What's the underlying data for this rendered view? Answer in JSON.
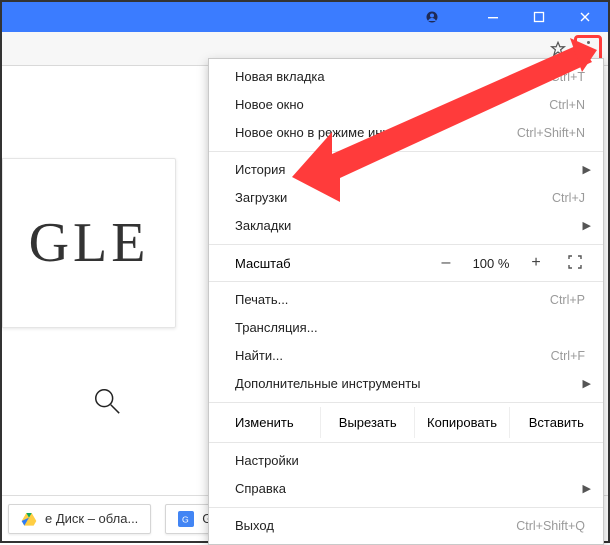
{
  "titlebar": {
    "profile_icon": "user-circle",
    "minimize_icon": "minimize",
    "maximize_icon": "maximize",
    "close_icon": "close"
  },
  "omnirow": {
    "star_icon": "star-outline",
    "kebab_icon": "more-vertical"
  },
  "page": {
    "doodle_text": "GLE",
    "search_icon": "magnifier"
  },
  "menu": {
    "new_tab": {
      "label": "Новая вкладка",
      "accel": "Ctrl+T"
    },
    "new_window": {
      "label": "Новое окно",
      "accel": "Ctrl+N"
    },
    "incognito": {
      "label": "Новое окно в режиме инкогнито",
      "accel": "Ctrl+Shift+N"
    },
    "history": {
      "label": "История"
    },
    "downloads": {
      "label": "Загрузки",
      "accel": "Ctrl+J"
    },
    "bookmarks": {
      "label": "Закладки"
    },
    "zoom": {
      "label": "Масштаб",
      "minus": "–",
      "value": "100 %",
      "plus": "+"
    },
    "print": {
      "label": "Печать...",
      "accel": "Ctrl+P"
    },
    "cast": {
      "label": "Трансляция..."
    },
    "find": {
      "label": "Найти...",
      "accel": "Ctrl+F"
    },
    "more_tools": {
      "label": "Дополнительные инструменты"
    },
    "edit": {
      "label": "Изменить",
      "cut": "Вырезать",
      "copy": "Копировать",
      "paste": "Вставить"
    },
    "settings": {
      "label": "Настройки"
    },
    "help": {
      "label": "Справка"
    },
    "exit": {
      "label": "Выход",
      "accel": "Ctrl+Shift+Q"
    }
  },
  "tabs": {
    "drive": {
      "label": "е Диск – обла..."
    },
    "translate": {
      "label": "Google Переводчик"
    }
  },
  "annotation": {
    "arrow_color": "#ff3b3b"
  }
}
